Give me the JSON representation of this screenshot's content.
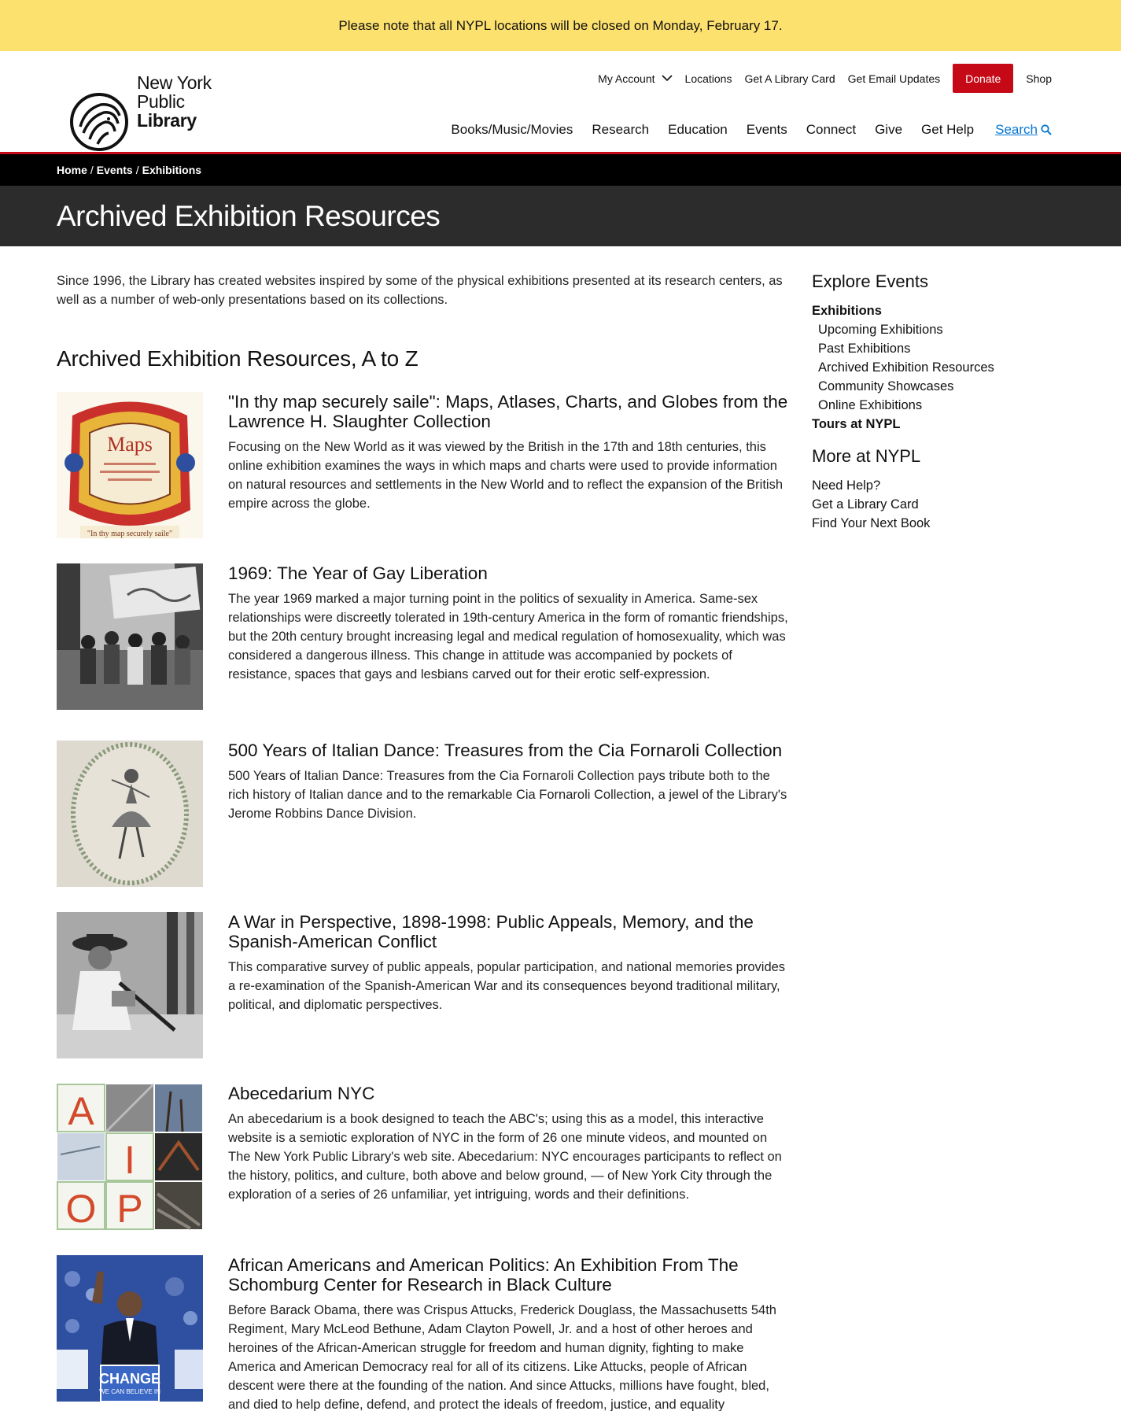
{
  "alert": {
    "text": "Please note that all NYPL locations will be closed on Monday, February 17."
  },
  "logo": {
    "line1": "New York",
    "line2": "Public",
    "line3": "Library"
  },
  "utility_nav": {
    "my_account": "My Account",
    "locations": "Locations",
    "library_card": "Get A Library Card",
    "email_updates": "Get Email Updates",
    "donate": "Donate",
    "shop": "Shop"
  },
  "main_nav": {
    "items": [
      "Books/Music/Movies",
      "Research",
      "Education",
      "Events",
      "Connect",
      "Give",
      "Get Help"
    ],
    "search": "Search"
  },
  "breadcrumb": {
    "home": "Home",
    "events": "Events",
    "exhibitions": "Exhibitions"
  },
  "page_title": "Archived Exhibition Resources",
  "intro": "Since 1996, the Library has created websites inspired by some of the physical exhibitions presented at its research centers, as well as a number of web-only presentations based on its collections.",
  "section_heading": "Archived Exhibition Resources, A to Z",
  "items": [
    {
      "title": "\"In thy map securely saile\": Maps, Atlases, Charts, and Globes from the Lawrence H. Slaughter Collection",
      "desc": "Focusing on the New World as it was viewed by the British in the 17th and 18th centuries, this online exhibition examines the ways in which maps and charts were used to provide information on natural resources and settlements in the New World and to reflect the expansion of the British empire across the globe.",
      "thumb_text": "Maps",
      "thumb_sub": "\"In thy map securely saile\""
    },
    {
      "title": "1969: The Year of Gay Liberation",
      "desc": "The year 1969 marked a major turning point in the politics of sexuality in America. Same-sex relationships were discreetly tolerated in 19th-century America in the form of romantic friendships, but the 20th century brought increasing legal and medical regulation of homosexuality, which was considered a dangerous illness. This change in attitude was accompanied by pockets of resistance, spaces that gays and lesbians carved out for their erotic self-expression."
    },
    {
      "title": "500 Years of Italian Dance: Treasures from the Cia Fornaroli Collection",
      "desc": "500 Years of Italian Dance: Treasures from the Cia Fornaroli Collection pays tribute both to the rich history of Italian dance and to the remarkable Cia Fornaroli Collection, a jewel of the Library's Jerome Robbins Dance Division."
    },
    {
      "title": "A War in Perspective, 1898-1998: Public Appeals, Memory, and the Spanish-American Conflict",
      "desc": "This comparative survey of public appeals, popular participation, and national memories provides a re-examination of the Spanish-American War and its consequences beyond traditional military, political, and diplomatic perspectives."
    },
    {
      "title": "Abecedarium NYC",
      "desc": "An abecedarium is a book designed to teach the ABC's; using this as a model, this interactive website is a semiotic exploration of NYC in the form of 26 one minute videos, and mounted on The New York Public Library's web site. Abecedarium: NYC encourages participants to reflect on the history, politics, and culture, both above and below ground, — of New York City through the exploration of a series of 26 unfamiliar, yet intriguing, words and their definitions.",
      "letters": [
        "A",
        "I",
        "O",
        "P"
      ]
    },
    {
      "title": "African Americans and American Politics: An Exhibition From The Schomburg Center for Research in Black Culture",
      "desc": "Before Barack Obama, there was Crispus Attucks, Frederick Douglass, the Massachusetts 54th Regiment, Mary McLeod Bethune, Adam Clayton Powell, Jr. and a host of other heroes and heroines of the African-American struggle for freedom and human dignity, fighting to make America and American Democracy real for all of its citizens. Like Attucks, people of African descent were there at the founding of the nation. And since Attucks, millions have fought, bled, and died to help define, defend, and protect the ideals of freedom, justice, and equality",
      "sign_line1": "CHANGE",
      "sign_line2": "WE CAN BELIEVE IN"
    }
  ],
  "sidebar": {
    "explore_heading": "Explore Events",
    "exhibitions": "Exhibitions",
    "upcoming": "Upcoming Exhibitions",
    "past": "Past Exhibitions",
    "archived": "Archived Exhibition Resources",
    "community": "Community Showcases",
    "online": "Online Exhibitions",
    "tours": "Tours at NYPL",
    "more_heading": "More at NYPL",
    "need_help": "Need Help?",
    "library_card": "Get a Library Card",
    "next_book": "Find Your Next Book"
  },
  "colors": {
    "alert_bg": "#fde16f",
    "donate": "#c60917",
    "search_link": "#0576d3",
    "title_bar": "#2c2c2c"
  }
}
